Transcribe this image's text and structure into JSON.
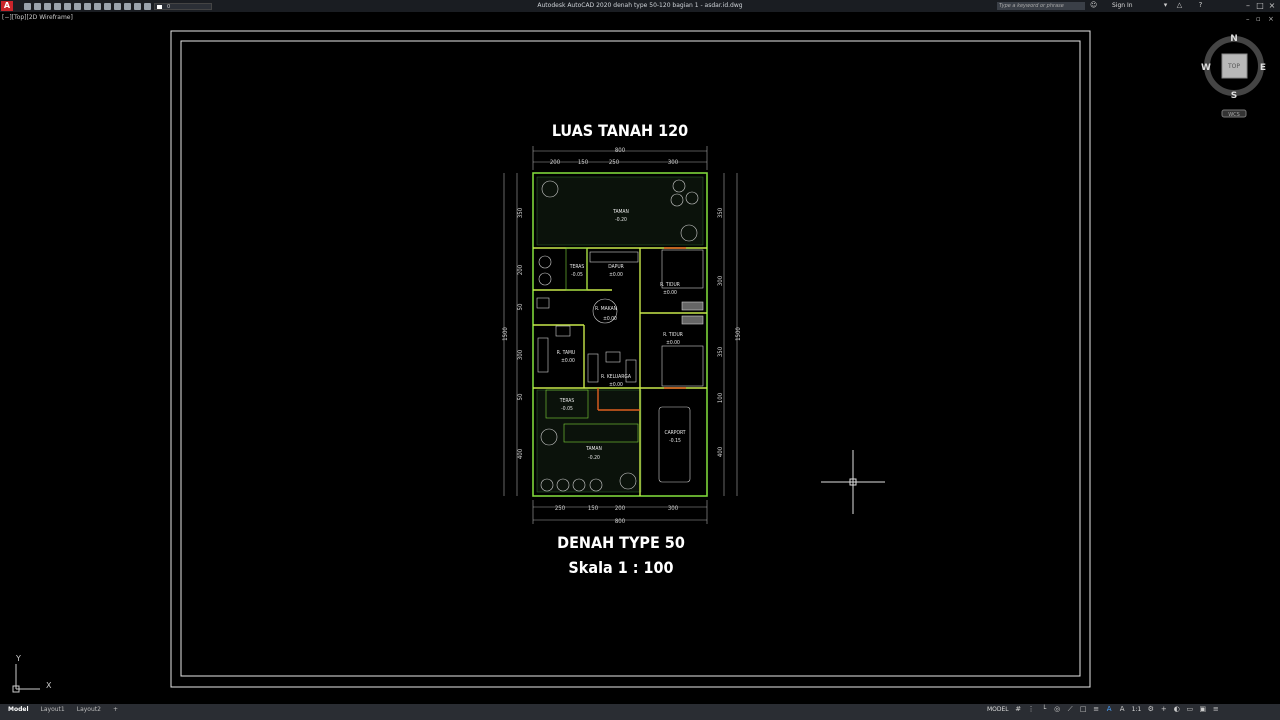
{
  "app": {
    "title": "Autodesk AutoCAD 2020    denah type 50-120 bagian 1 - asdar.id.dwg",
    "logo": "A",
    "layer_name": "0",
    "search_placeholder": "Type a keyword or phrase",
    "sign_in": "Sign In",
    "view_label": "[−][Top][2D Wireframe]"
  },
  "drawing": {
    "top_title": "LUAS TANAH 120",
    "bottom_title": "DENAH TYPE 50",
    "scale": "Skala 1 : 100",
    "top_dims": [
      "200",
      "150",
      "250",
      "300"
    ],
    "top_total": "800",
    "bottom_dims": [
      "250",
      "150",
      "200",
      "300"
    ],
    "bottom_total": "800",
    "left_dims": [
      "350",
      "200",
      "50",
      "300",
      "50",
      "400"
    ],
    "left_total": "1500",
    "right_dims": [
      "350",
      "300",
      "350",
      "100",
      "400"
    ],
    "right_total": "1500",
    "rooms": [
      {
        "name": "TAMAN",
        "level": "-0.20"
      },
      {
        "name": "TERAS",
        "level": "-0.05"
      },
      {
        "name": "DAPUR",
        "level": "±0.00"
      },
      {
        "name": "R. TIDUR",
        "level": "±0.00"
      },
      {
        "name": "R. MAKAN",
        "level": "±0.00"
      },
      {
        "name": "R. TIDUR",
        "level": "±0.00"
      },
      {
        "name": "R. TAMU",
        "level": "±0.00"
      },
      {
        "name": "R. KELUARGA",
        "level": "±0.00"
      },
      {
        "name": "TERAS",
        "level": "-0.05"
      },
      {
        "name": "CARPORT",
        "level": "-0.15"
      },
      {
        "name": "TAMAN",
        "level": "-0.20"
      }
    ]
  },
  "viewcube": {
    "north": "N",
    "south": "S",
    "east": "E",
    "west": "W",
    "face": "TOP",
    "wcs": "WCS"
  },
  "ucs": {
    "x": "X",
    "y": "Y"
  },
  "tabs": [
    "Model",
    "Layout1",
    "Layout2"
  ],
  "status": {
    "model": "MODEL",
    "scale": "1:1"
  }
}
